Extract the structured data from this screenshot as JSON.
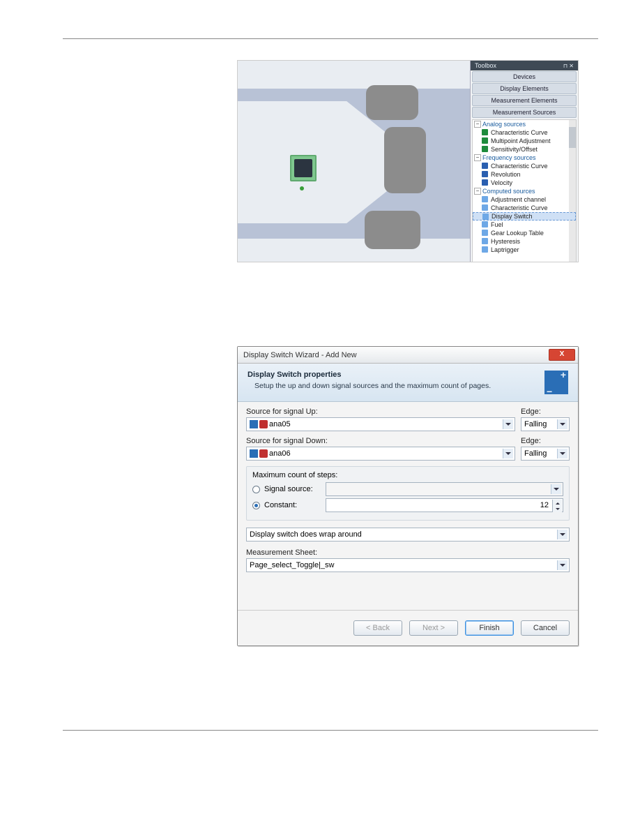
{
  "toolbox": {
    "title": "Toolbox",
    "bands": [
      "Devices",
      "Display Elements",
      "Measurement Elements",
      "Measurement Sources"
    ],
    "groups": [
      {
        "label": "Analog sources",
        "items": [
          {
            "label": "Characteristic Curve",
            "ic": "g"
          },
          {
            "label": "Multipoint Adjustment",
            "ic": "g"
          },
          {
            "label": "Sensitivity/Offset",
            "ic": "g"
          }
        ]
      },
      {
        "label": "Frequency sources",
        "items": [
          {
            "label": "Characteristic Curve",
            "ic": "b"
          },
          {
            "label": "Revolution",
            "ic": "b"
          },
          {
            "label": "Velocity",
            "ic": "b"
          }
        ]
      },
      {
        "label": "Computed sources",
        "items": [
          {
            "label": "Adjustment channel",
            "ic": "l"
          },
          {
            "label": "Characteristic Curve",
            "ic": "l"
          },
          {
            "label": "Display Switch",
            "ic": "l",
            "sel": true
          },
          {
            "label": "Fuel",
            "ic": "l"
          },
          {
            "label": "Gear Lookup Table",
            "ic": "l"
          },
          {
            "label": "Hysteresis",
            "ic": "l"
          },
          {
            "label": "Laptrigger",
            "ic": "l"
          }
        ]
      }
    ]
  },
  "wizard": {
    "title": "Display Switch Wizard - Add New",
    "close": "X",
    "heading": "Display Switch properties",
    "subheading": "Setup the up and down signal sources and the maximum count of pages.",
    "lbl_source_up": "Source for signal Up:",
    "val_source_up": "ana05",
    "lbl_edge": "Edge:",
    "val_edge_up": "Falling",
    "lbl_source_down": "Source for signal Down:",
    "val_source_down": "ana06",
    "val_edge_down": "Falling",
    "lbl_max_steps": "Maximum count of steps:",
    "radio_signal": "Signal source:",
    "radio_constant": "Constant:",
    "val_constant": "12",
    "wrap": "Display switch does wrap around",
    "lbl_sheet": "Measurement Sheet:",
    "val_sheet": "Page_select_Toggle|_sw",
    "btn_back": "< Back",
    "btn_next": "Next >",
    "btn_finish": "Finish",
    "btn_cancel": "Cancel"
  }
}
